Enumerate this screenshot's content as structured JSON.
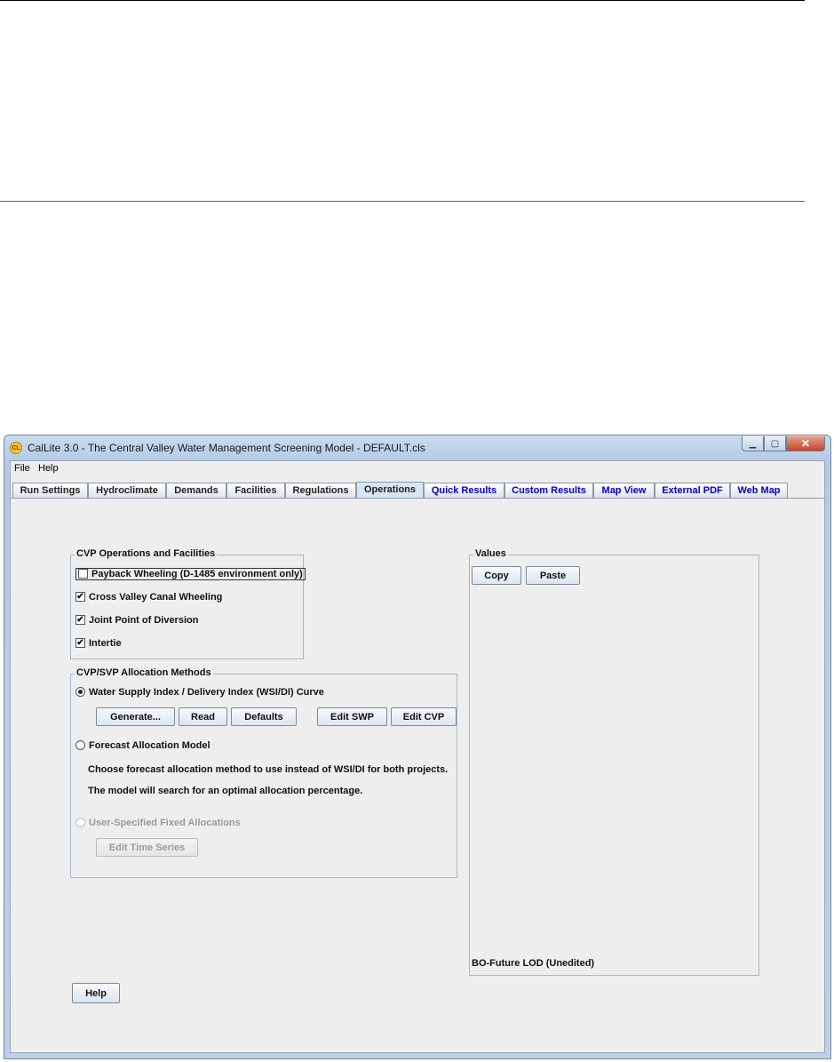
{
  "window": {
    "app_icon_text": "CL",
    "title": "CalLite 3.0 -  The Central Valley Water Management Screening Model - DEFAULT.cls",
    "minimize_glyph": "▁",
    "maximize_glyph": "▢",
    "close_glyph": "✕"
  },
  "menu": {
    "file": "File",
    "help": "Help"
  },
  "tabs": [
    {
      "label": "Run Settings"
    },
    {
      "label": "Hydroclimate"
    },
    {
      "label": "Demands"
    },
    {
      "label": "Facilities"
    },
    {
      "label": "Regulations"
    },
    {
      "label": "Operations",
      "active": true
    },
    {
      "label": "Quick Results"
    },
    {
      "label": "Custom Results"
    },
    {
      "label": "Map View"
    },
    {
      "label": "External PDF"
    },
    {
      "label": "Web Map"
    }
  ],
  "cvp_ops": {
    "title": "CVP Operations and Facilities",
    "items": [
      {
        "label": "Payback Wheeling (D-1485 environment only)",
        "checked": false
      },
      {
        "label": "Cross Valley Canal Wheeling",
        "checked": true
      },
      {
        "label": "Joint Point of Diversion",
        "checked": true
      },
      {
        "label": "Intertie",
        "checked": true
      }
    ],
    "check_glyph": "✔"
  },
  "allocation": {
    "title": "CVP/SVP Allocation Methods",
    "option_wsi": "Water Supply Index / Delivery Index (WSI/DI) Curve",
    "generate": "Generate...",
    "read": "Read",
    "defaults": "Defaults",
    "edit_swp": "Edit SWP",
    "edit_cvp": "Edit CVP",
    "option_forecast": "Forecast Allocation Model",
    "forecast_note_1": "Choose forecast allocation method to use instead of WSI/DI for both projects.",
    "forecast_note_2": "The model will search for an optimal allocation percentage.",
    "option_fixed": "User-Specified Fixed Allocations",
    "edit_time_series": "Edit Time Series"
  },
  "values": {
    "title": "Values",
    "copy": "Copy",
    "paste": "Paste",
    "status": "BO-Future LOD (Unedited)"
  },
  "help_button": "Help",
  "colors": {
    "tab_link": "#0000d0",
    "active_tab": "#d7e6f5",
    "client_bg": "#eeeeee"
  }
}
